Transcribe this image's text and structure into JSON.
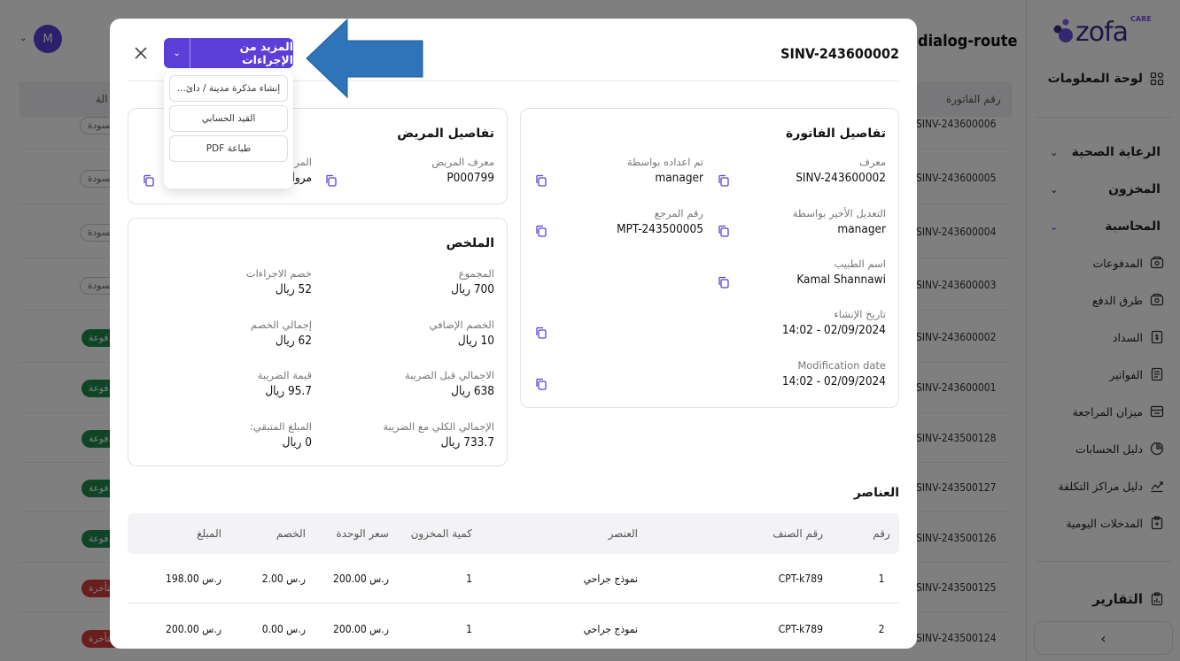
{
  "app": {
    "brand_name": "zofa",
    "brand_suffix": "CARE",
    "avatar_initial": "M",
    "page_title": "dialog-route"
  },
  "sidebar": {
    "dashboard": "لوحة المعلومات",
    "sections": [
      {
        "label": "الرعاية الصحية"
      },
      {
        "label": "المخزون"
      },
      {
        "label": "المحاسبة"
      }
    ],
    "accounting_items": [
      {
        "label": "المدفوعات",
        "icon": "wallet-icon"
      },
      {
        "label": "طرق الدفع",
        "icon": "wallet-icon"
      },
      {
        "label": "السداد",
        "icon": "receipt-icon"
      },
      {
        "label": "الفواتير",
        "icon": "document-icon"
      },
      {
        "label": "ميزان المراجعة",
        "icon": "ledger-icon"
      },
      {
        "label": "دليل الحسابات",
        "icon": "pie-chart-icon"
      },
      {
        "label": "دليل مراكز التكلفة",
        "icon": "trend-chart-icon"
      },
      {
        "label": "المدخلات اليومية",
        "icon": "clipboard-icon"
      }
    ],
    "reports": "التقارير",
    "collapse_glyph": "›"
  },
  "background_table": {
    "col_invoice_no": "رقم الفاتورة",
    "col_status_partial": "الة",
    "rows": [
      {
        "id": "SINV-243600006",
        "status": "مسودة"
      },
      {
        "id": "SINV-243600005",
        "status": "مسودة"
      },
      {
        "id": "SINV-243600004",
        "status": "مسودة"
      },
      {
        "id": "SINV-243600003",
        "status": "مسودة"
      },
      {
        "id": "SINV-243600002",
        "status": "مدفوعة"
      },
      {
        "id": "SINV-243600001",
        "status": "مدفوعة"
      },
      {
        "id": "SINV-243500128",
        "status": "مدفوعة"
      },
      {
        "id": "SINV-243500127",
        "status": "مدفوعة"
      },
      {
        "id": "SINV-243500126",
        "status": "مدفوعة"
      },
      {
        "id": "SINV-243500125",
        "status": "متأخرة"
      },
      {
        "id": "SINV-243500124",
        "status": "متأخرة"
      }
    ]
  },
  "modal": {
    "title": "SINV-243600002",
    "actions_label": "المزيد من الإجراءات",
    "actions_menu": [
      "إنشاء مذكرة مدينة / دائ...",
      "القيد الحسابي",
      "طباعة PDF"
    ],
    "invoice_details": {
      "title": "تفاصيل الفاتورة",
      "id_label": "معرف",
      "id_value": "SINV-243600002",
      "prepared_by_label": "تم اعداده بواسطة",
      "prepared_by_value": "manager",
      "modified_by_label": "التعديل الأخير بواسطة",
      "modified_by_value": "manager",
      "reference_label": "رقم المرجع",
      "reference_value": "MPT-243500005",
      "doctor_label": "اسم الطبيب",
      "doctor_value": "Kamal Shannawi",
      "created_label": "تاريخ الإنشاء",
      "created_value": "02/09/2024 - 14:02",
      "modified_label": "Modification date",
      "modified_value": "02/09/2024 - 14:02"
    },
    "patient_details": {
      "title": "تفاصيل المريض",
      "patient_id_label": "معرف المريض",
      "patient_id_value": "P000799",
      "patient_name_label": "المر",
      "patient_name_value": "مروا"
    },
    "summary": {
      "title": "الملخص",
      "total_label": "المجموع",
      "total_value": "700 ريال",
      "procedures_discount_label": "خصم الاجراءات",
      "procedures_discount_value": "52 ريال",
      "extra_discount_label": "الخصم الإضافي",
      "extra_discount_value": "10 ريال",
      "total_discount_label": "إجمالي الخصم",
      "total_discount_value": "62 ريال",
      "pre_tax_label": "الاجمالي قبل الضريبة",
      "pre_tax_value": "638 ريال",
      "tax_label": "قيمة الضريبة",
      "tax_value": "95.7 ريال",
      "grand_total_label": "الإجمالي الكلي مع الضريبة",
      "grand_total_value": "733.7 ريال",
      "remaining_label": "المبلغ المتبقي:",
      "remaining_value": "0 ريال"
    },
    "items": {
      "title": "العناصر",
      "headers": [
        "رقم",
        "رقم الصنف",
        "العنصر",
        "كمية المخزون",
        "سعر الوحدة",
        "الخصم",
        "المبلغ"
      ],
      "rows": [
        [
          "1",
          "CPT-k789",
          "نموذج جراحي",
          "1",
          "200.00 ر.س",
          "2.00 ر.س",
          "198.00 ر.س"
        ],
        [
          "2",
          "CPT-k789",
          "نموذج جراحي",
          "1",
          "200.00 ر.س",
          "0.00 ر.س",
          "200.00 ر.س"
        ]
      ]
    }
  },
  "colors": {
    "primary": "#5b3fd6",
    "annotation_arrow": "#2f74b8",
    "paid": "#1e8a4c",
    "late": "#d23a3a"
  }
}
